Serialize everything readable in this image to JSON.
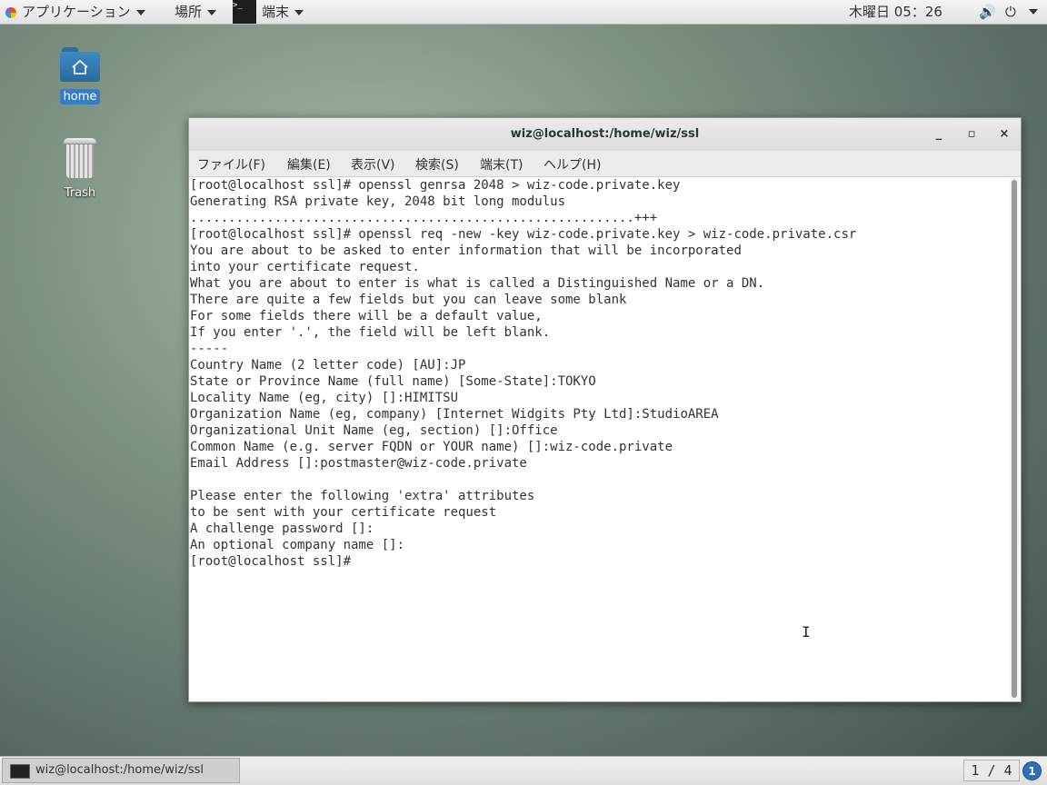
{
  "topbar": {
    "applications_label": "アプリケーション",
    "places_label": "場所",
    "terminal_label": "端末",
    "clock": "木曜日 05：26",
    "volume_icon": "volume-icon",
    "power_icon": "power-icon"
  },
  "desktop": {
    "home_label": "home",
    "trash_label": "Trash"
  },
  "window": {
    "title": "wiz@localhost:/home/wiz/ssl",
    "minimize": "_",
    "maximize": "▫",
    "close": "×"
  },
  "menu": [
    "ファイル(F)",
    "編集(E)",
    "表示(V)",
    "検索(S)",
    "端末(T)",
    "ヘルプ(H)"
  ],
  "terminal_lines": [
    "[root@localhost ssl]# openssl genrsa 2048 > wiz-code.private.key",
    "Generating RSA private key, 2048 bit long modulus",
    "..........................................................+++",
    "[root@localhost ssl]# openssl req -new -key wiz-code.private.key > wiz-code.private.csr",
    "You are about to be asked to enter information that will be incorporated",
    "into your certificate request.",
    "What you are about to enter is what is called a Distinguished Name or a DN.",
    "There are quite a few fields but you can leave some blank",
    "For some fields there will be a default value,",
    "If you enter '.', the field will be left blank.",
    "-----",
    "Country Name (2 letter code) [AU]:JP",
    "State or Province Name (full name) [Some-State]:TOKYO",
    "Locality Name (eg, city) []:HIMITSU",
    "Organization Name (eg, company) [Internet Widgits Pty Ltd]:StudioAREA",
    "Organizational Unit Name (eg, section) []:Office",
    "Common Name (e.g. server FQDN or YOUR name) []:wiz-code.private",
    "Email Address []:postmaster@wiz-code.private",
    "",
    "Please enter the following 'extra' attributes",
    "to be sent with your certificate request",
    "A challenge password []:",
    "An optional company name []:",
    "[root@localhost ssl]# "
  ],
  "taskbar": {
    "task_label": "wiz@localhost:/home/wiz/ssl",
    "workspace": "1 / 4",
    "notifications": "1"
  }
}
